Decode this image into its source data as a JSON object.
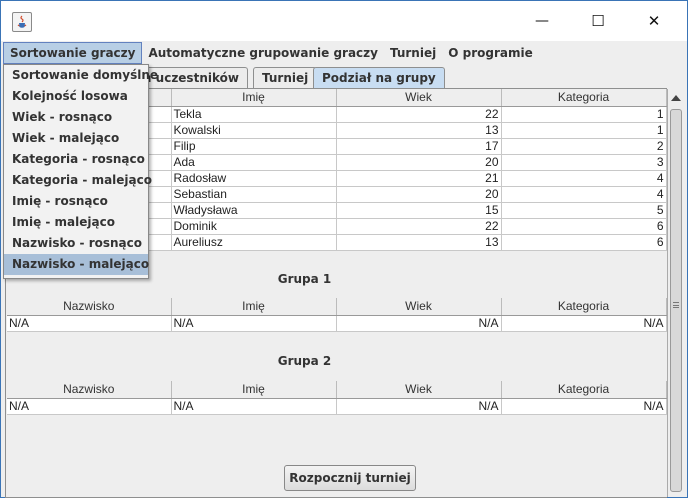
{
  "window": {
    "minimize": "—",
    "maximize": "☐",
    "close": "✕"
  },
  "menubar": [
    "Sortowanie graczy",
    "Automatyczne grupowanie graczy",
    "Turniej",
    "O programie"
  ],
  "dropdown": [
    "Sortowanie domyślne",
    "Kolejność losowa",
    "Wiek - rosnąco",
    "Wiek - malejąco",
    "Kategoria - rosnąco",
    "Kategoria - malejąco",
    "Imię - rosnąco",
    "Imię - malejąco",
    "Nazwisko - rosnąco",
    "Nazwisko - malejąco"
  ],
  "tabs": [
    "ych uczestników",
    "Turniej",
    "Podział na grupy"
  ],
  "players": {
    "columns": [
      "Imię",
      "Wiek",
      "Kategoria"
    ],
    "rows": [
      [
        "Tekla",
        "22",
        "1"
      ],
      [
        "Kowalski",
        "13",
        "1"
      ],
      [
        "Filip",
        "17",
        "2"
      ],
      [
        "Ada",
        "20",
        "3"
      ],
      [
        "Radosław",
        "21",
        "4"
      ],
      [
        "Sebastian",
        "20",
        "4"
      ],
      [
        "Władysława",
        "15",
        "5"
      ],
      [
        "Dominik",
        "22",
        "6"
      ],
      [
        "Aureliusz",
        "13",
        "6"
      ]
    ]
  },
  "groups": [
    {
      "title": "Grupa 1",
      "columns": [
        "Nazwisko",
        "Imię",
        "Wiek",
        "Kategoria"
      ],
      "row": [
        "N/A",
        "N/A",
        "N/A",
        "N/A"
      ]
    },
    {
      "title": "Grupa 2",
      "columns": [
        "Nazwisko",
        "Imię",
        "Wiek",
        "Kategoria"
      ],
      "row": [
        "N/A",
        "N/A",
        "N/A",
        "N/A"
      ]
    }
  ],
  "start_button": "Rozpocznij turniej"
}
